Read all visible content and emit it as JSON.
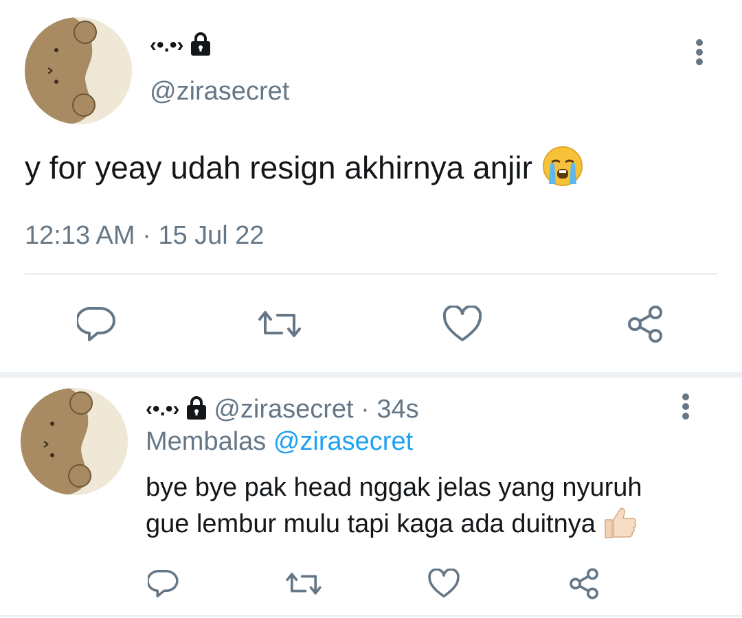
{
  "main_tweet": {
    "display_name": "‹•.•›",
    "protected_icon": "lock-icon",
    "handle": "@zirasecret",
    "text": "y for yeay udah resign akhirnya anjir",
    "emoji": "loudly-crying-face-emoji",
    "timestamp": "12:13 AM · 15 Jul 22",
    "actions": [
      "reply-icon",
      "retweet-icon",
      "like-icon",
      "share-icon"
    ]
  },
  "reply_tweet": {
    "display_name": "‹•.•›",
    "protected_icon": "lock-icon",
    "handle": "@zirasecret",
    "meta_sep": " · ",
    "age": "34s",
    "replying_label": "Membalas",
    "replying_to": "@zirasecret",
    "text_line1": "bye bye pak head nggak jelas yang nyuruh",
    "text_line2": "gue lembur mulu tapi kaga ada duitnya",
    "emoji": "thumbs-up-emoji",
    "actions": [
      "reply-icon",
      "retweet-icon",
      "like-icon",
      "share-icon"
    ]
  },
  "colors": {
    "text": "#14171a",
    "secondary": "#657786",
    "link": "#1da1f2",
    "divider": "#e6ecf0"
  }
}
